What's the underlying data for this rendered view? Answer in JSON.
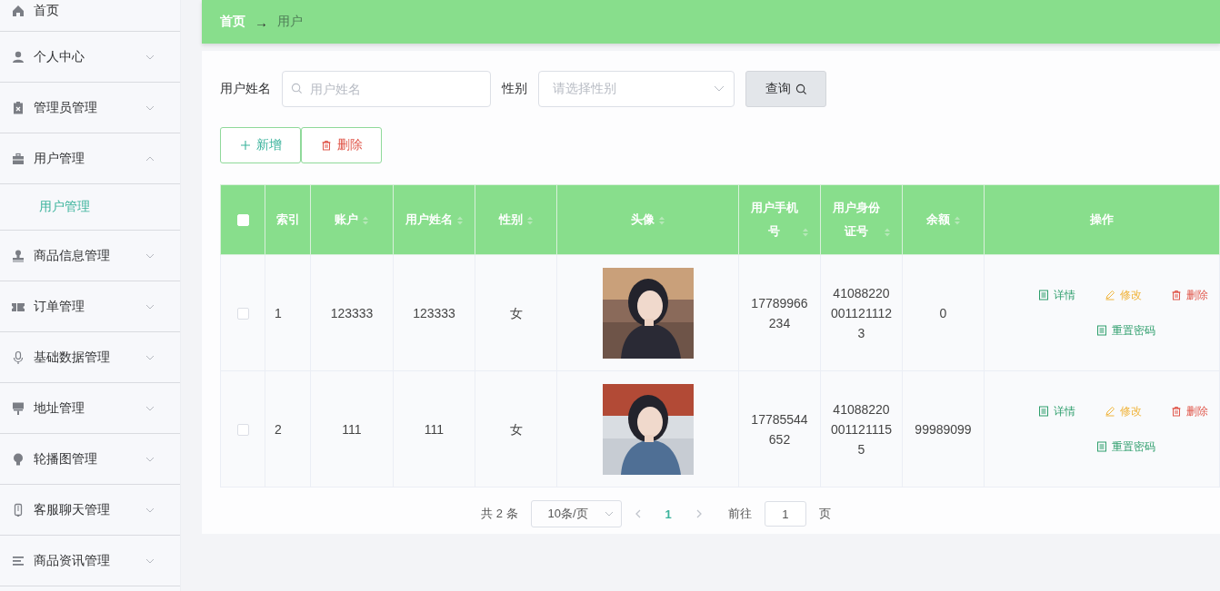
{
  "sidebar": {
    "items": [
      {
        "label": "首页"
      },
      {
        "label": "个人中心",
        "expanded": false
      },
      {
        "label": "管理员管理",
        "expanded": false
      },
      {
        "label": "用户管理",
        "expanded": true,
        "children": [
          {
            "label": "用户管理",
            "selected": true
          }
        ]
      },
      {
        "label": "商品信息管理",
        "expanded": false
      },
      {
        "label": "订单管理",
        "expanded": false
      },
      {
        "label": "基础数据管理",
        "expanded": false
      },
      {
        "label": "地址管理",
        "expanded": false
      },
      {
        "label": "轮播图管理",
        "expanded": false
      },
      {
        "label": "客服聊天管理",
        "expanded": false
      },
      {
        "label": "商品资讯管理",
        "expanded": false
      }
    ]
  },
  "breadcrumb": {
    "items": [
      "首页",
      "用户"
    ],
    "separator": "→"
  },
  "search": {
    "name_label": "用户姓名",
    "name_placeholder": "用户姓名",
    "gender_label": "性别",
    "gender_placeholder": "请选择性别",
    "button": "查询"
  },
  "actions": [
    {
      "kind": "add",
      "label": "新增"
    },
    {
      "kind": "delete",
      "label": "删除"
    }
  ],
  "table": {
    "select_all_checked": false,
    "columns": [
      {
        "label": "索引",
        "sortable": false
      },
      {
        "label": "账户",
        "sortable": true
      },
      {
        "label": "用户姓名",
        "sortable": true
      },
      {
        "label": "性别",
        "sortable": true
      },
      {
        "label": "头像",
        "sortable": true
      },
      {
        "label": "用户手机号",
        "sortable": true
      },
      {
        "label": "用户身份证号",
        "sortable": true
      },
      {
        "label": "余额",
        "sortable": true
      },
      {
        "label": "操作",
        "sortable": false
      }
    ],
    "rows": [
      {
        "checked": false,
        "index": "1",
        "account": "123333",
        "name": "123333",
        "gender": "女",
        "phone": "17789966234",
        "id_number": "410882200011211123",
        "balance": "0",
        "operations": [
          {
            "kind": "detail",
            "label": "详情"
          },
          {
            "kind": "edit",
            "label": "修改"
          },
          {
            "kind": "delete",
            "label": "删除"
          },
          {
            "kind": "reset",
            "label": "重置密码"
          }
        ]
      },
      {
        "checked": false,
        "index": "2",
        "account": "111",
        "name": "111",
        "gender": "女",
        "phone": "17785544652",
        "id_number": "410882200011211155",
        "balance": "99989099",
        "operations": [
          {
            "kind": "detail",
            "label": "详情"
          },
          {
            "kind": "edit",
            "label": "修改"
          },
          {
            "kind": "delete",
            "label": "删除"
          },
          {
            "kind": "reset",
            "label": "重置密码"
          }
        ]
      }
    ]
  },
  "pagination": {
    "total": "共 2 条",
    "page_size": "10条/页",
    "pages": [
      {
        "label": "1",
        "selected": true
      }
    ],
    "goto_label": "前往",
    "goto_value": "1",
    "goto_suffix": "页"
  }
}
